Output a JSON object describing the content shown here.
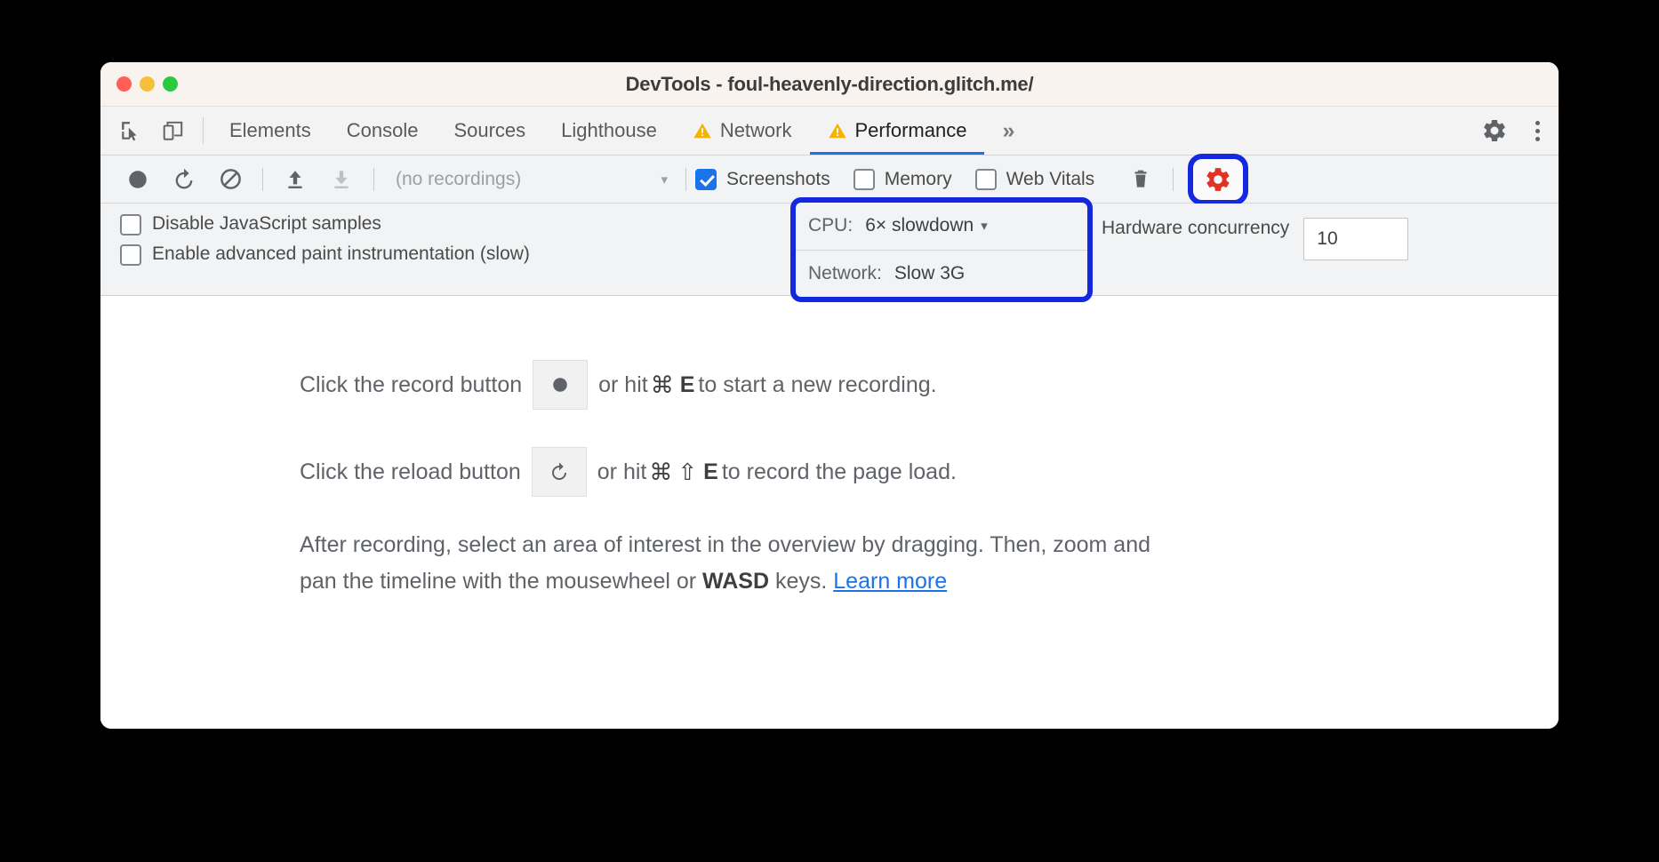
{
  "window": {
    "title": "DevTools - foul-heavenly-direction.glitch.me/",
    "traffic_lights": [
      "close",
      "minimize",
      "maximize"
    ]
  },
  "tabbar": {
    "left_icons": [
      {
        "name": "inspect-element-icon",
        "label": "Inspect element"
      },
      {
        "name": "device-toolbar-icon",
        "label": "Toggle device toolbar"
      }
    ],
    "tabs": [
      {
        "label": "Elements",
        "warning": false,
        "active": false
      },
      {
        "label": "Console",
        "warning": false,
        "active": false
      },
      {
        "label": "Sources",
        "warning": false,
        "active": false
      },
      {
        "label": "Lighthouse",
        "warning": false,
        "active": false
      },
      {
        "label": "Network",
        "warning": true,
        "active": false
      },
      {
        "label": "Performance",
        "warning": true,
        "active": true
      }
    ],
    "more_tabs": "»",
    "right_icons": [
      {
        "name": "settings-gear-icon",
        "label": "Settings"
      },
      {
        "name": "more-options-kebab-icon",
        "label": "More options"
      }
    ]
  },
  "toolbar": {
    "record_label": "Record",
    "reload_label": "Start profiling and reload page",
    "clear_label": "Clear",
    "load_label": "Load profile",
    "save_label": "Save profile",
    "recordings_value": "(no recordings)",
    "recordings_arrow": "▾",
    "checkboxes": [
      {
        "label": "Screenshots",
        "checked": true
      },
      {
        "label": "Memory",
        "checked": false
      },
      {
        "label": "Web Vitals",
        "checked": false
      }
    ],
    "trash_label": "Clear recording",
    "capture_settings_label": "Capture settings"
  },
  "settings": {
    "options": [
      {
        "label": "Disable JavaScript samples",
        "checked": false
      },
      {
        "label": "Enable advanced paint instrumentation (slow)",
        "checked": false
      }
    ],
    "throttling": {
      "cpu_label": "CPU:",
      "cpu_value": "6× slowdown",
      "cpu_arrow": "▾",
      "network_label": "Network:",
      "network_value": "Slow 3G"
    },
    "hardware_concurrency": {
      "label": "Hardware concurrency",
      "checked": false,
      "value": "10"
    },
    "tick_mark": "`"
  },
  "content": {
    "line1_before": "Click the record button",
    "line1_after_a": "or hit",
    "line1_cmd": "⌘",
    "line1_key": "E",
    "line1_after_b": "to start a new recording.",
    "line2_before": "Click the reload button",
    "line2_after_a": "or hit",
    "line2_cmd": "⌘",
    "line2_shift": "⇧",
    "line2_key": "E",
    "line2_after_b": "to record the page load.",
    "paragraph_1": "After recording, select an area of interest in the overview by dragging. Then, zoom and pan the timeline with the mousewheel or ",
    "paragraph_keys": "WASD",
    "paragraph_2": " keys. ",
    "learn_more": "Learn more"
  },
  "colors": {
    "accent_blue": "#1a73e8",
    "highlight_blue": "#1428e0",
    "gear_red": "#e03225",
    "warning_yellow": "#f5b400",
    "titlebar_bg": "#f8f3ef",
    "toolbar_bg": "#f1f3f4"
  }
}
